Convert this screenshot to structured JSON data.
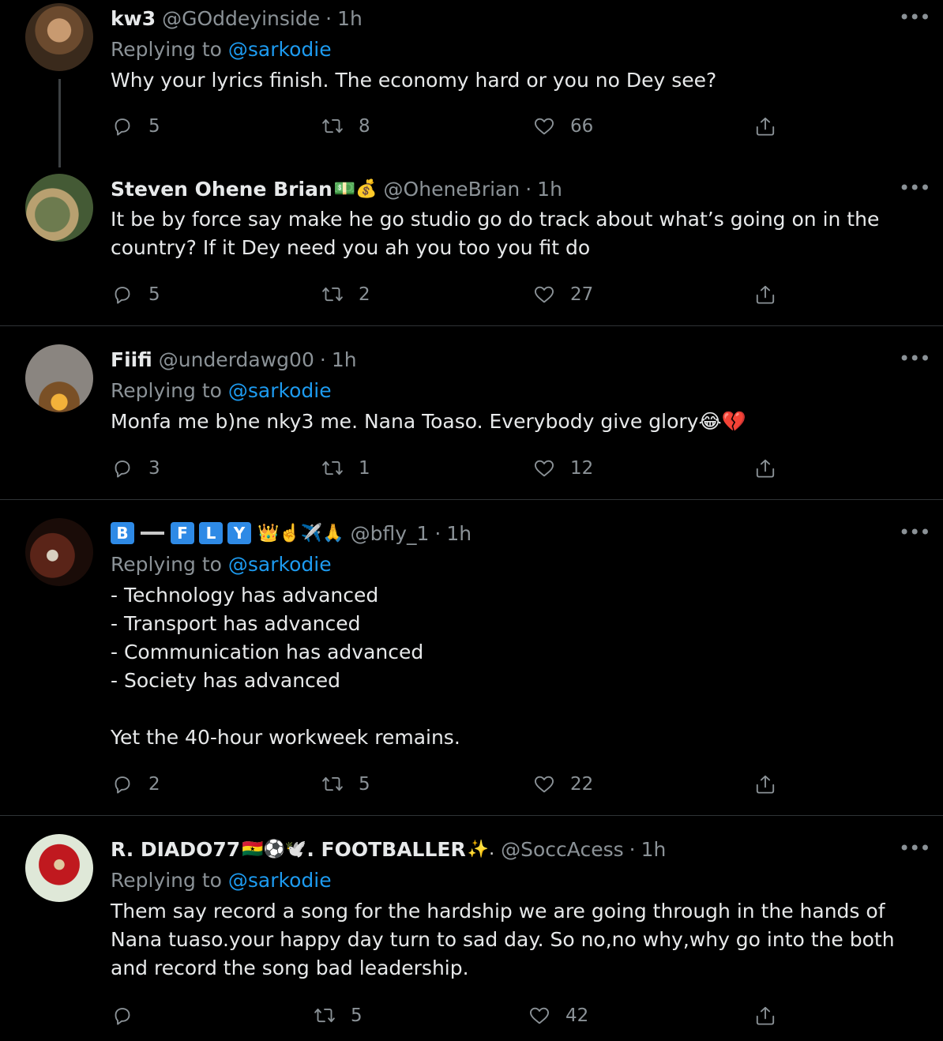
{
  "tweets": [
    {
      "name": "kw3",
      "handle": "@GOddeyinside",
      "time": "1h",
      "replying_label": "Replying to",
      "replying_to": "@sarkodie",
      "text": "Why your lyrics finish. The economy hard or you no Dey see?",
      "replies": "5",
      "retweets": "8",
      "likes": "66"
    },
    {
      "name": "Steven Ohene Brian",
      "name_emoji": "💵💰",
      "handle": "@OheneBrian",
      "time": "1h",
      "text": "It be by force say make he go studio go do track about what’s going on in the\ncountry? If it Dey need you ah you too you fit do",
      "replies": "5",
      "retweets": "2",
      "likes": "27"
    },
    {
      "name": "Fiifi",
      "handle": "@underdawg00",
      "time": "1h",
      "replying_label": "Replying to",
      "replying_to": "@sarkodie",
      "text": "Monfa me b)ne nky3 me. Nana Toaso. Everybody give glory😂💔",
      "replies": "3",
      "retweets": "1",
      "likes": "12"
    },
    {
      "name_letters": [
        "B",
        "F",
        "L",
        "Y"
      ],
      "name_emoji": "👑☝️✈️🙏",
      "handle": "@bfly_1",
      "time": "1h",
      "replying_label": "Replying to",
      "replying_to": "@sarkodie",
      "text": "- Technology has advanced\n- Transport has advanced\n- Communication has advanced\n- Society has advanced\n\nYet the 40-hour workweek remains.",
      "replies": "2",
      "retweets": "5",
      "likes": "22"
    },
    {
      "name": "R. DIADO77",
      "name_emoji_mid": "🇬🇭⚽🕊️",
      "name_suffix": ". FOOTBALLER",
      "name_emoji_end": "✨.",
      "handle": "@SoccAcess",
      "time": "1h",
      "replying_label": "Replying to",
      "replying_to": "@sarkodie",
      "text": "Them say record a song for the hardship we are going through in the hands of\nNana tuaso.your happy day turn to sad day. So no,no why,why go into the both\nand record the song bad leadership.",
      "replies": "",
      "retweets": "5",
      "likes": "42"
    }
  ],
  "ui": {
    "dot": "·",
    "more": "•••"
  },
  "colors": {
    "background": "#000000",
    "link": "#1d9bf0",
    "muted": "#8b9297",
    "text": "#e7e9ea"
  }
}
